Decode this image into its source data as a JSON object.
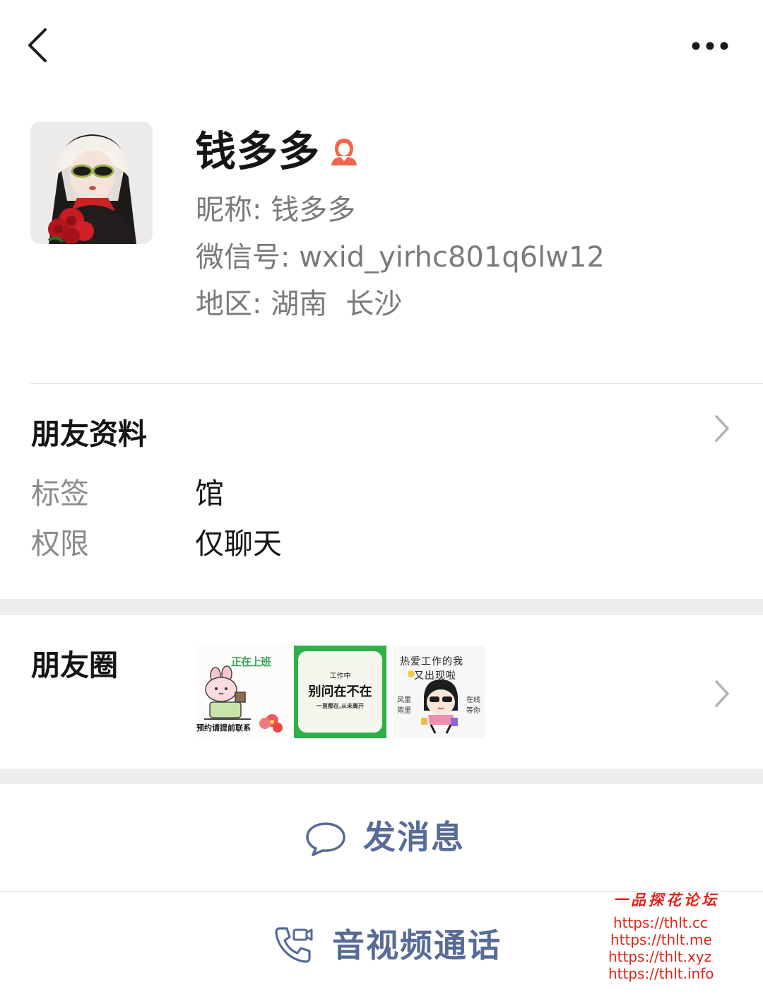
{
  "profile": {
    "display_name": "钱多多",
    "nickname_label": "昵称:",
    "nickname": "钱多多",
    "wxid_label": "微信号:",
    "wxid": "wxid_yirhc801q6lw12",
    "region_label": "地区:",
    "region_province": "湖南",
    "region_city": "长沙"
  },
  "friend_info": {
    "title": "朋友资料",
    "rows": [
      {
        "label": "标签",
        "value": "馆"
      },
      {
        "label": "权限",
        "value": "仅聊天"
      }
    ]
  },
  "moments": {
    "title": "朋友圈",
    "thumbs": [
      {
        "badge": "正在上班",
        "caption": "预约请提前联系"
      },
      {
        "small": "工作中",
        "main": "别问在不在",
        "sub": "一直都在,从未离开"
      },
      {
        "line1": "热爱工作的我",
        "line2": "又出现啦",
        "left": "风里\n雨里",
        "right": "在线\n等你"
      }
    ]
  },
  "actions": {
    "message": "发消息",
    "call": "音视频通话"
  },
  "watermark": {
    "title": "一品探花论坛",
    "urls": [
      "https://thlt.cc",
      "https://thlt.me",
      "https://thlt.xyz",
      "https://thlt.info"
    ]
  },
  "colors": {
    "link_blue": "#576b95",
    "gender_female": "#f06848",
    "watermark_red": "#e2231a",
    "section_gap": "#ededed"
  },
  "icons": {
    "back": "chevron-left-icon",
    "more": "more-dots-icon",
    "gender": "female-icon",
    "chevron": "chevron-right-icon",
    "message": "chat-bubble-icon",
    "call": "phone-video-icon"
  }
}
